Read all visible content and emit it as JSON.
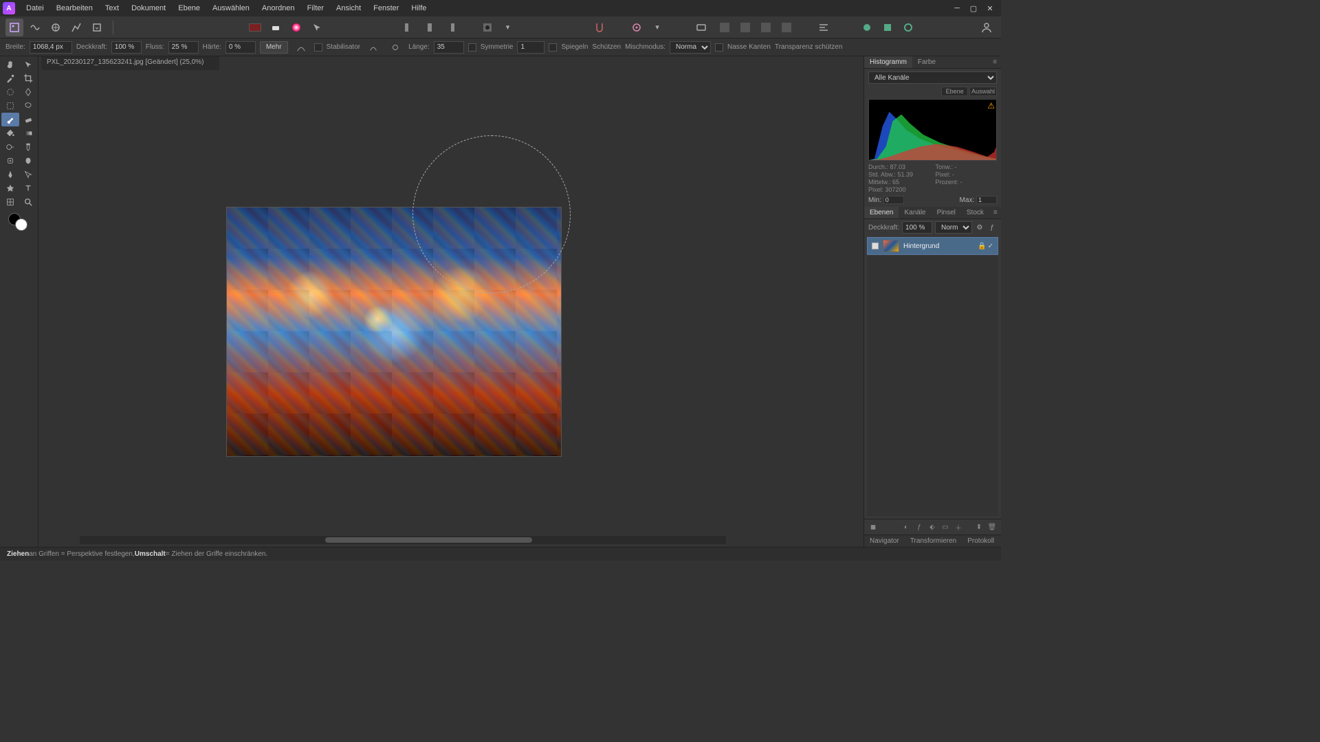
{
  "menu": [
    "Datei",
    "Bearbeiten",
    "Text",
    "Dokument",
    "Ebene",
    "Auswählen",
    "Anordnen",
    "Filter",
    "Ansicht",
    "Fenster",
    "Hilfe"
  ],
  "contextBar": {
    "breite_label": "Breite:",
    "breite_val": "1068,4 px",
    "deck_label": "Deckkraft:",
    "deck_val": "100 %",
    "fluss_label": "Fluss:",
    "fluss_val": "25 %",
    "haerte_label": "Härte:",
    "haerte_val": "0 %",
    "mehr": "Mehr",
    "stabil": "Stabilisator",
    "laenge_label": "Länge:",
    "laenge_val": "35",
    "sym_label": "Symmetrie",
    "sym_val": "1",
    "spiegeln": "Spiegeln",
    "schuetzen": "Schützen",
    "misch_label": "Mischmodus:",
    "misch_val": "Normal",
    "nasse": "Nasse Kanten",
    "transp": "Transparenz schützen"
  },
  "doc": {
    "tab": "PXL_20230127_135623241.jpg [Geändert] (25,0%)"
  },
  "histogram": {
    "tab1": "Histogramm",
    "tab2": "Farbe",
    "channel": "Alle Kanäle",
    "sub_ebene": "Ebene",
    "sub_auswahl": "Auswahl",
    "durch": "Durch.: 87.03",
    "tonw": "Tonw.: -",
    "stdabw": "Std. Abw.: 51.39",
    "pixelr": "Pixel: -",
    "mittel": "Mittelw.: 65",
    "prozent": "Prozent: -",
    "pixel": "Pixel: 307200",
    "min_label": "Min:",
    "min_val": "0",
    "max_label": "Max:",
    "max_val": "1"
  },
  "layers": {
    "tab1": "Ebenen",
    "tab2": "Kanäle",
    "tab3": "Pinsel",
    "tab4": "Stock",
    "opac_label": "Deckkraft:",
    "opac_val": "100 %",
    "blend": "Normal",
    "layer1": "Hintergrund"
  },
  "bottomTabs": [
    "Navigator",
    "Transformieren",
    "Protokoll"
  ],
  "status": {
    "s1": "Ziehen",
    "s2": " an Griffen = Perspektive festlegen, ",
    "s3": "Umschalt",
    "s4": " = Ziehen der Griffe einschränken."
  }
}
